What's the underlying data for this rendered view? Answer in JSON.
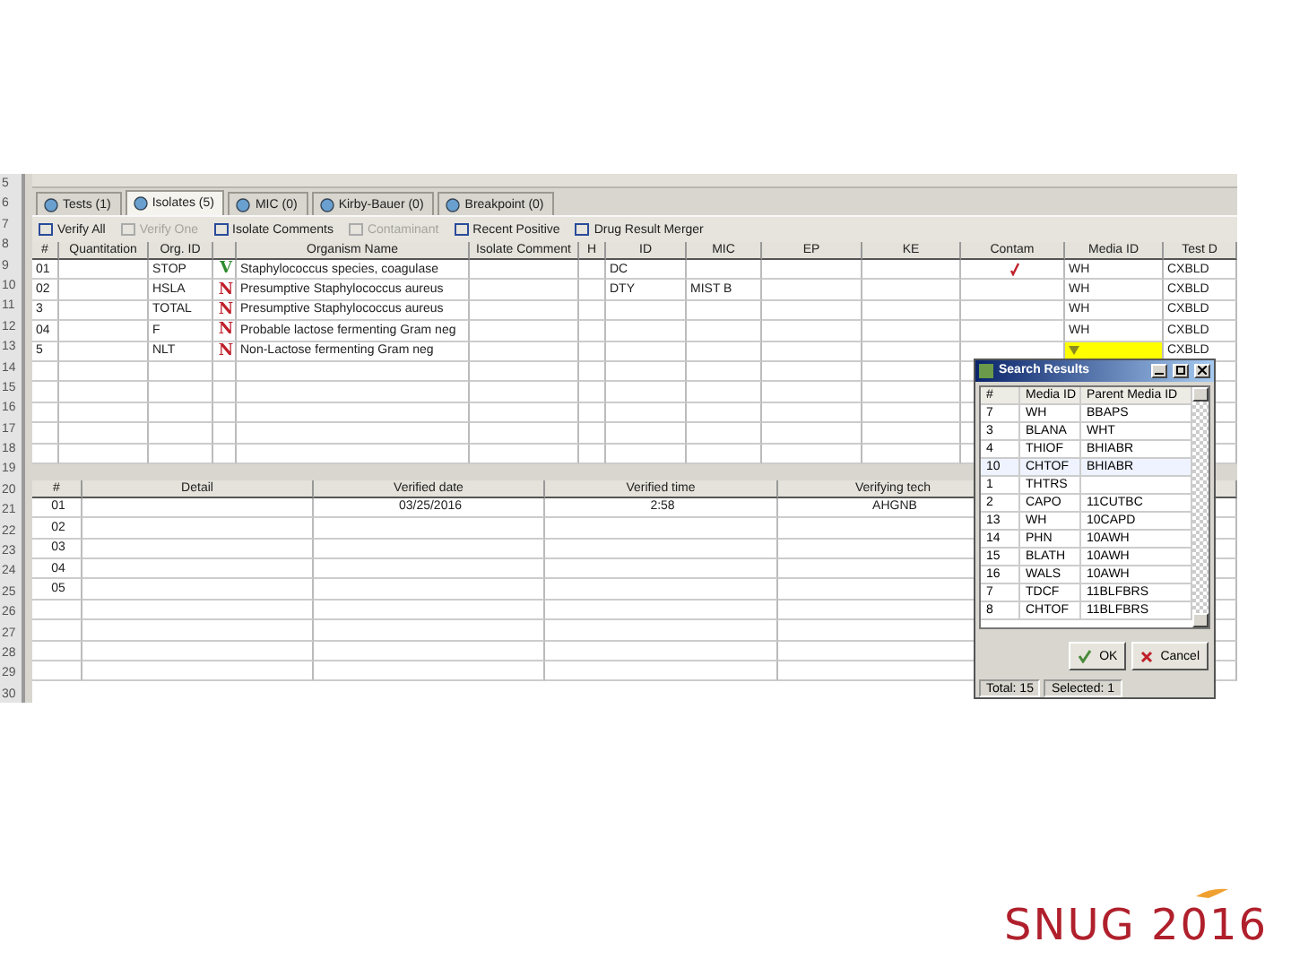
{
  "row_numbers": [
    "5",
    "6",
    "7",
    "8",
    "9",
    "10",
    "11",
    "12",
    "13",
    "14",
    "15",
    "16",
    "17",
    "18",
    "19",
    "20",
    "21",
    "22",
    "23",
    "24",
    "25",
    "26",
    "27",
    "28",
    "29",
    "30"
  ],
  "tabs": [
    {
      "label": "Tests (1)",
      "selected": false
    },
    {
      "label": "Isolates (5)",
      "selected": true
    },
    {
      "label": "MIC (0)",
      "selected": false
    },
    {
      "label": "Kirby-Bauer (0)",
      "selected": false
    },
    {
      "label": "Breakpoint (0)",
      "selected": false
    }
  ],
  "toolbar": [
    {
      "label": "Verify All",
      "disabled": false
    },
    {
      "label": "Verify One",
      "disabled": true
    },
    {
      "label": "Isolate Comments",
      "disabled": false
    },
    {
      "label": "Contaminant",
      "disabled": true
    },
    {
      "label": "Recent Positive",
      "disabled": false
    },
    {
      "label": "Drug Result Merger",
      "disabled": false
    }
  ],
  "isolates": {
    "columns": [
      "#",
      "Quantitation",
      "Org. ID",
      "",
      "Organism Name",
      "Isolate Comment",
      "H",
      "ID",
      "MIC",
      "EP",
      "KE",
      "Contam",
      "Media ID",
      "Test D"
    ],
    "rows": [
      {
        "num": "01",
        "org_id": "STOP",
        "flag": "V",
        "color": "#2e8b2e",
        "organism": "Staphylococcus species, coagulase",
        "id": "DC",
        "mic": "",
        "contaminant": true,
        "media_id": "WH",
        "editing": false,
        "test": "CXBLD"
      },
      {
        "num": "02",
        "org_id": "HSLA",
        "flag": "N",
        "color": "#c0202a",
        "organism": "Presumptive Staphylococcus aureus",
        "id": "DTY",
        "mic": "MIST B",
        "contaminant": false,
        "media_id": "WH",
        "editing": false,
        "test": "CXBLD"
      },
      {
        "num": "3",
        "org_id": "TOTAL",
        "flag": "N",
        "color": "#c0202a",
        "organism": "Presumptive Staphylococcus aureus",
        "id": "",
        "mic": "",
        "contaminant": false,
        "media_id": "WH",
        "editing": false,
        "test": "CXBLD"
      },
      {
        "num": "04",
        "org_id": "F",
        "flag": "N",
        "color": "#c0202a",
        "organism": "Probable lactose fermenting Gram neg",
        "id": "",
        "mic": "",
        "contaminant": false,
        "media_id": "WH",
        "editing": false,
        "test": "CXBLD"
      },
      {
        "num": "5",
        "org_id": "NLT",
        "flag": "N",
        "color": "#c0202a",
        "organism": "Non-Lactose fermenting Gram neg",
        "id": "",
        "mic": "",
        "contaminant": false,
        "media_id": "",
        "editing": true,
        "test": "CXBLD"
      }
    ]
  },
  "verification": {
    "columns": [
      "#",
      "Detail",
      "Verified date",
      "Verified time",
      "Verifying tech"
    ],
    "rows": [
      {
        "num": "01",
        "date": "03/25/2016",
        "time": "2:58",
        "tech": "AHGNB"
      },
      {
        "num": "02"
      },
      {
        "num": "03"
      },
      {
        "num": "04"
      },
      {
        "num": "05"
      }
    ]
  },
  "search_dialog": {
    "title": "Search Results",
    "columns": [
      "#",
      "Media ID",
      "Parent Media ID"
    ],
    "rows": [
      {
        "num": "7",
        "media": "WH",
        "parent": "BBAPS",
        "selected": false
      },
      {
        "num": "3",
        "media": "BLANA",
        "parent": "WHT",
        "selected": false
      },
      {
        "num": "4",
        "media": "THIOF",
        "parent": "BHIABR",
        "selected": false
      },
      {
        "num": "10",
        "media": "CHTOF",
        "parent": "BHIABR",
        "selected": true
      },
      {
        "num": "1",
        "media": "THTRS",
        "parent": "",
        "selected": false
      },
      {
        "num": "2",
        "media": "CAPO",
        "parent": "11CUTBC",
        "selected": false
      },
      {
        "num": "13",
        "media": "WH",
        "parent": "10CAPD",
        "selected": false
      },
      {
        "num": "14",
        "media": "PHN",
        "parent": "10AWH",
        "selected": false
      },
      {
        "num": "15",
        "media": "BLATH",
        "parent": "10AWH",
        "selected": false
      },
      {
        "num": "16",
        "media": "WALS",
        "parent": "10AWH",
        "selected": false
      },
      {
        "num": "7",
        "media": "TDCF",
        "parent": "11BLFBRS",
        "selected": false
      },
      {
        "num": "8",
        "media": "CHTOF",
        "parent": "11BLFBRS",
        "selected": false
      }
    ],
    "ok": "OK",
    "cancel": "Cancel",
    "total": "Total: 15",
    "selected_count": "Selected: 1"
  },
  "logo": "SNUG 2016"
}
